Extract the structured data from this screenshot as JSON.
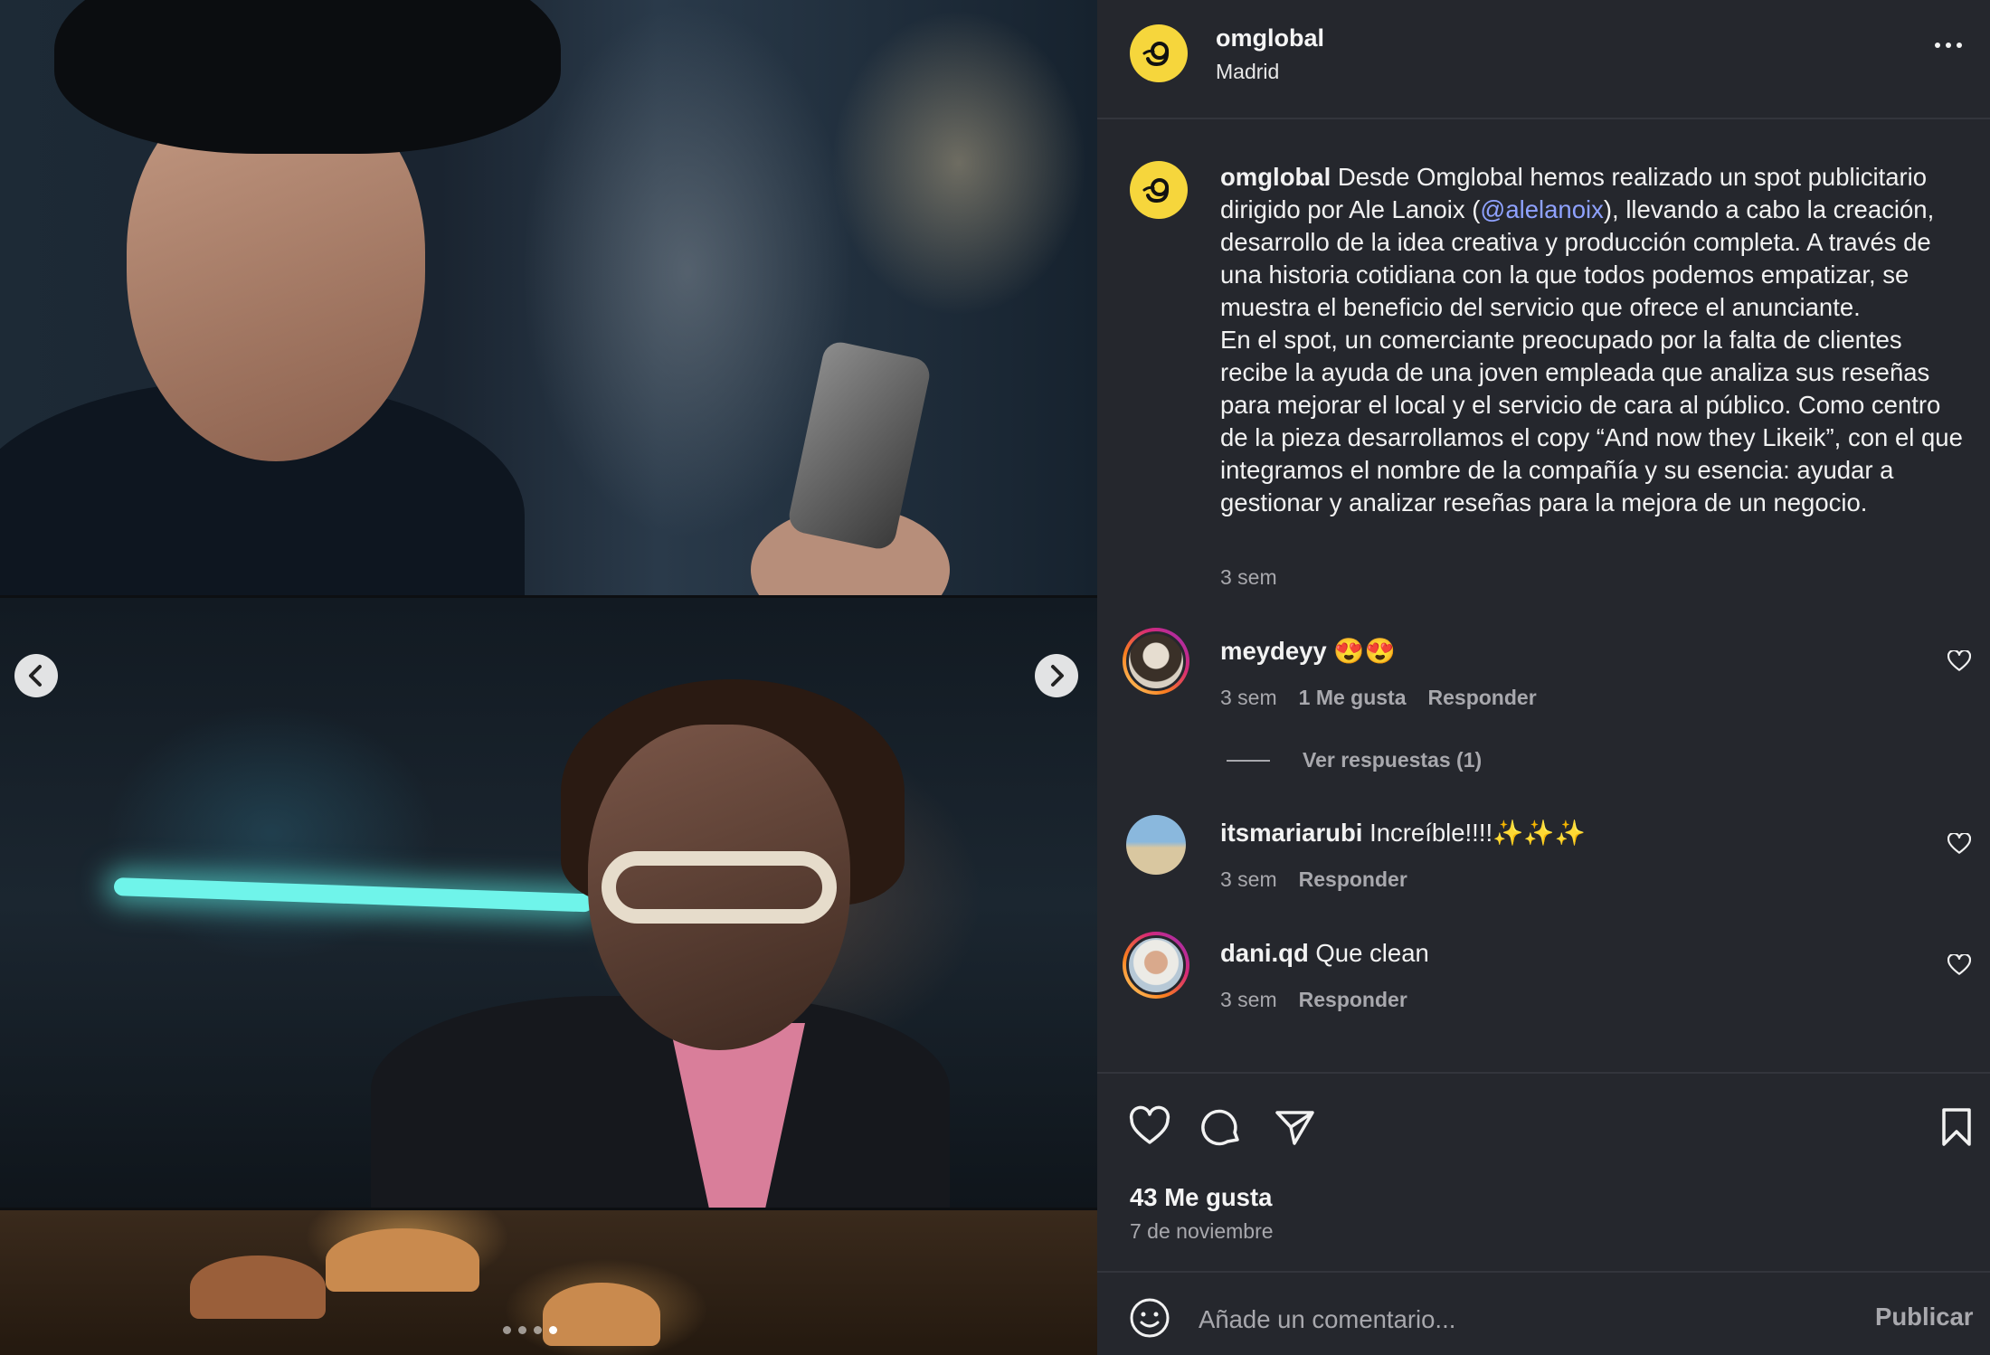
{
  "post": {
    "username": "omglobal",
    "location": "Madrid",
    "caption_before": " Desde Omglobal hemos realizado un spot publicitario dirigido por Ale Lanoix (",
    "caption_mention": "@alelanoix",
    "caption_after": "), llevando a cabo la creación, desarrollo de la idea creativa y producción completa. A través de una historia cotidiana con la que todos podemos empatizar, se muestra el beneficio del servicio que ofrece el anunciante.",
    "caption_paragraph2": "En el spot, un comerciante preocupado por la falta de clientes recibe la ayuda de una joven empleada que analiza sus reseñas para mejorar el local y el servicio de cara al público. Como centro de la pieza desarrollamos el copy “And now they Likeik”, con el que integramos el nombre de la compañía y su esencia: ayudar a gestionar y analizar reseñas para la mejora de un negocio.",
    "caption_time": "3 sem",
    "likes": "43 Me gusta",
    "date": "7 de noviembre"
  },
  "comments": [
    {
      "user": "meydeyy",
      "text": "😍😍",
      "time": "3 sem",
      "likes": "1 Me gusta",
      "reply": "Responder",
      "view_replies": "Ver respuestas (1)"
    },
    {
      "user": "itsmariarubi",
      "text": "Increíble!!!!✨✨✨",
      "time": "3 sem",
      "reply": "Responder"
    },
    {
      "user": "dani.qd",
      "text": "Que clean",
      "time": "3 sem",
      "reply": "Responder"
    }
  ],
  "composer": {
    "placeholder": "Añade un comentario...",
    "publish_label": "Publicar"
  },
  "carousel": {
    "current_slide": 4,
    "total_slides": 4
  },
  "icons": {
    "more": "more-horizontal-icon",
    "prev": "chevron-left-icon",
    "next": "chevron-right-icon",
    "like": "heart-icon",
    "comment": "comment-icon",
    "share": "send-icon",
    "save": "bookmark-icon",
    "emoji": "emoji-icon",
    "comment_like": "heart-small-icon"
  },
  "colors": {
    "panel_bg": "#25272d",
    "logo_yellow": "#f6d63c",
    "mention_blue": "#8fa2ff",
    "muted_text": "#a8a8ad"
  }
}
